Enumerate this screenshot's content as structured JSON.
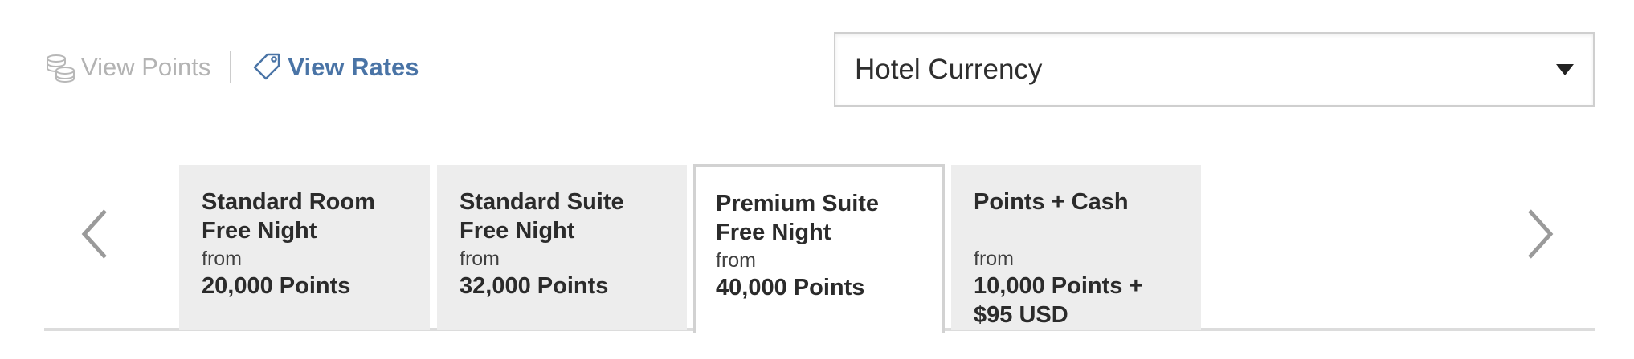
{
  "toggle": {
    "view_points_label": "View Points",
    "view_rates_label": "View Rates"
  },
  "currency_select": {
    "selected": "Hotel Currency"
  },
  "tabs": [
    {
      "title_line1": "Standard Room",
      "title_line2": "Free Night",
      "from": "from",
      "price_line1": "20,000 Points",
      "price_line2": ""
    },
    {
      "title_line1": "Standard Suite",
      "title_line2": "Free Night",
      "from": "from",
      "price_line1": "32,000 Points",
      "price_line2": ""
    },
    {
      "title_line1": "Premium Suite",
      "title_line2": "Free Night",
      "from": "from",
      "price_line1": "40,000 Points",
      "price_line2": ""
    },
    {
      "title_line1": "Points + Cash",
      "title_line2": "",
      "from": "from",
      "price_line1": "10,000 Points +",
      "price_line2": "$95 USD"
    }
  ],
  "active_tab_index": 2,
  "icons": {
    "points": "coins-icon",
    "rates": "price-tag-icon",
    "prev": "chevron-left-icon",
    "next": "chevron-right-icon",
    "dropdown": "caret-down-icon"
  },
  "colors": {
    "link_active": "#4a74a6",
    "link_inactive": "#b3b3b3",
    "tab_bg": "#ededed",
    "tab_active_bg": "#ffffff"
  }
}
